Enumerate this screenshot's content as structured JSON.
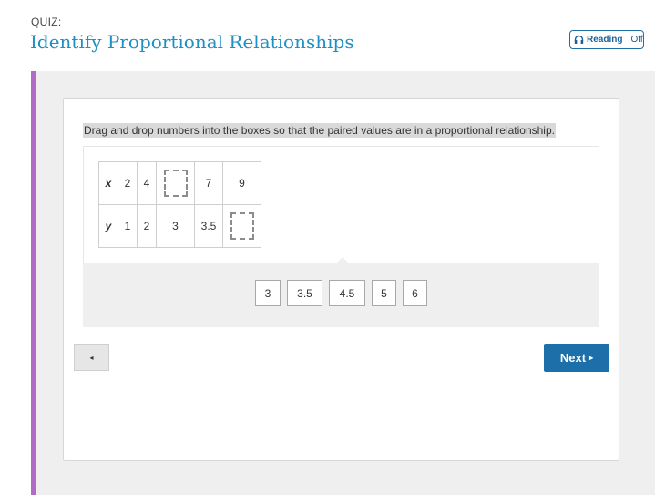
{
  "header": {
    "kicker": "QUIZ:",
    "title": "Identify Proportional Relationships",
    "reading": {
      "label": "Reading",
      "state": "Off",
      "icon": "headphones-icon"
    }
  },
  "question": {
    "prompt": "Drag and drop numbers into the boxes so that the paired values are in a proportional relationship.",
    "table": {
      "x_label": "x",
      "y_label": "y",
      "x_values": [
        "2",
        "4",
        "",
        "7",
        "9"
      ],
      "y_values": [
        "1",
        "2",
        "3",
        "3.5",
        ""
      ]
    },
    "tiles": [
      "3",
      "3.5",
      "4.5",
      "5",
      "6"
    ]
  },
  "nav": {
    "prev_symbol": "◂",
    "next_label": "Next",
    "next_symbol": "▸"
  },
  "colors": {
    "title": "#1f8fc4",
    "accent_bar": "#b06cc6",
    "next_button": "#1c6fa8"
  }
}
